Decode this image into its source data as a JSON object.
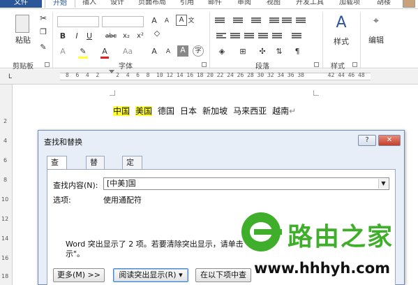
{
  "ribbon": {
    "tabs": [
      "文件",
      "开始",
      "插入",
      "设计",
      "页面布局",
      "引用",
      "邮件",
      "审阅",
      "视图",
      "开发工具",
      "加载项",
      "胡楼"
    ],
    "groups": [
      "剪贴板",
      "字体",
      "段落",
      "样式"
    ],
    "paste_label": "粘贴",
    "styles_label": "样式",
    "edit_label": "编辑",
    "font_buttons": [
      "B",
      "I",
      "U",
      "abc",
      "x₂",
      "x²"
    ],
    "font_row2": [
      "A",
      "A",
      "Aa",
      "A",
      "A",
      "A"
    ],
    "char_box": "A",
    "wen": "文",
    "zi": "字"
  },
  "ruler": {
    "numbers": "8  6  4  2     2  4  6  8  10 12 14 16 18 20 22 24 26 28 30 32 34 36 38       42 44 46 48",
    "tab_marker": "L",
    "vertical": [
      "2",
      "4",
      "6",
      "8",
      "10",
      "12",
      "14",
      "16",
      "18"
    ]
  },
  "document": {
    "words": [
      {
        "text": "中国",
        "highlight": true
      },
      {
        "text": "美国",
        "highlight": true
      },
      {
        "text": "德国",
        "highlight": false
      },
      {
        "text": "日本",
        "highlight": false
      },
      {
        "text": "新加坡",
        "highlight": false
      },
      {
        "text": "马来西亚",
        "highlight": false
      },
      {
        "text": "越南",
        "highlight": false
      }
    ],
    "para_mark": "↵"
  },
  "dialog": {
    "title": "查找和替换",
    "help": "?",
    "close": "✕",
    "tabs": [
      {
        "label": "查找(D)",
        "active": true
      },
      {
        "label": "替换(P)",
        "active": false
      },
      {
        "label": "定位(G)",
        "active": false
      }
    ],
    "find_label": "查找内容(N):",
    "find_value": "[中美]国",
    "options_label": "选项:",
    "options_value": "使用通配符",
    "message_line1": "Word 突出显示了 2 项。若要清除突出显示，请单击",
    "message_line2": "示\"。",
    "buttons": [
      "更多(M) >>",
      "阅读突出显示(R) ▾",
      "在以下项中查"
    ]
  },
  "watermark": {
    "title": "路由之家",
    "url": "www.hhhyh.com"
  },
  "colors": {
    "highlight": "#ffff33",
    "file_tab": "#2b579a",
    "watermark_green": "#3fae2a",
    "close_red": "#c2402a"
  }
}
